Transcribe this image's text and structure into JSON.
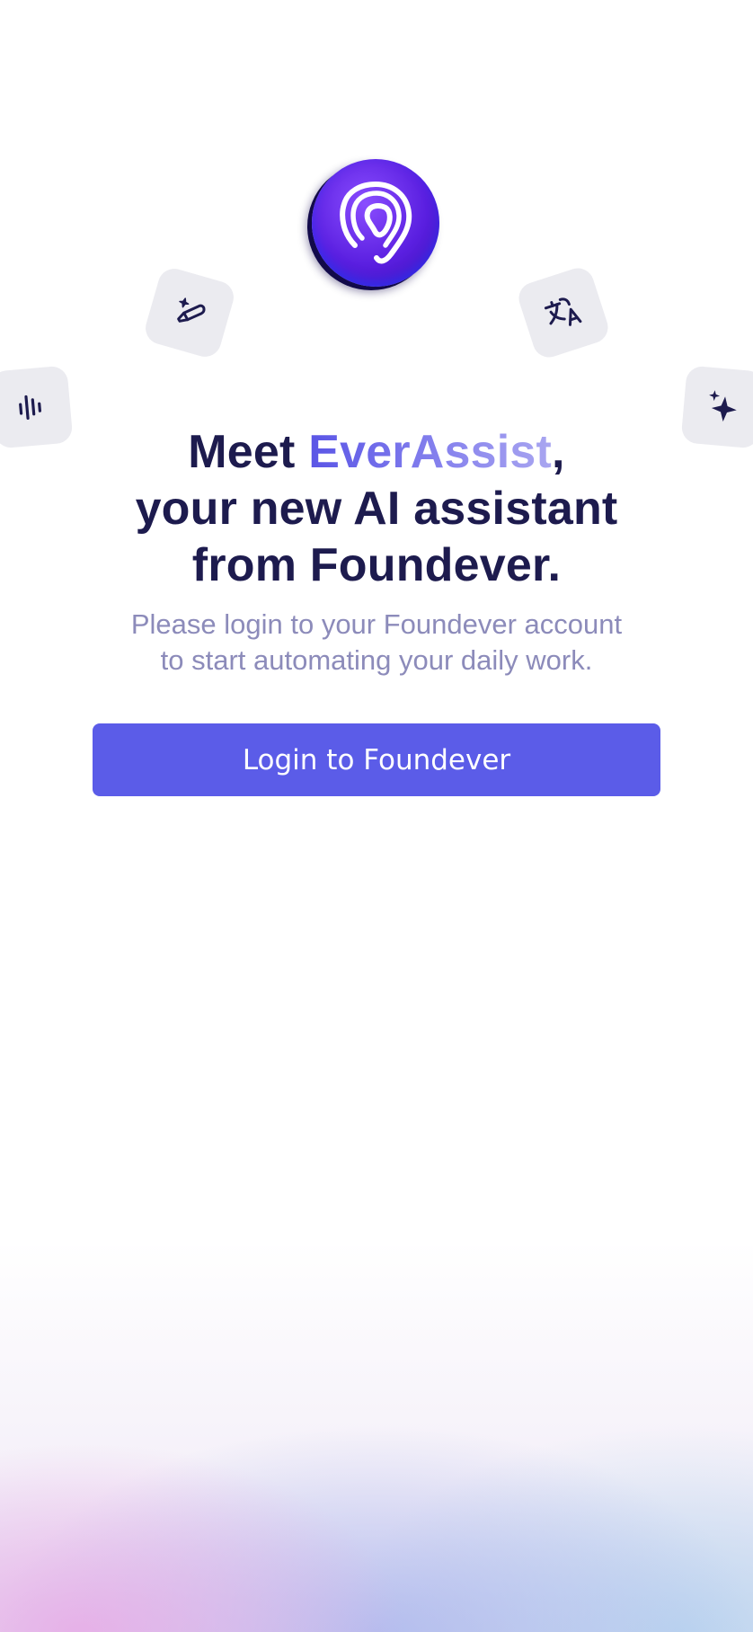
{
  "app": {
    "logo_name": "foundever-logo-icon"
  },
  "tiles": [
    {
      "icon": "pencil-sparkle-icon"
    },
    {
      "icon": "translate-icon"
    },
    {
      "icon": "voice-wave-icon"
    },
    {
      "icon": "sparkle-icon"
    }
  ],
  "headline": {
    "prefix": "Meet ",
    "brand": "EverAssist",
    "suffix": ",",
    "line2": "your new AI assistant",
    "line3": "from Foundever."
  },
  "subtitle": {
    "line1": "Please login to your Foundever account",
    "line2": "to start automating your daily work."
  },
  "login_button": {
    "label": "Login to Foundever"
  },
  "colors": {
    "heading": "#1d1b4e",
    "brand_accent": "#5a55e6",
    "subtitle": "#8c8bba",
    "button": "#5b5ce8",
    "tile": "#ebebf0",
    "logo": "#5a1fe0"
  }
}
